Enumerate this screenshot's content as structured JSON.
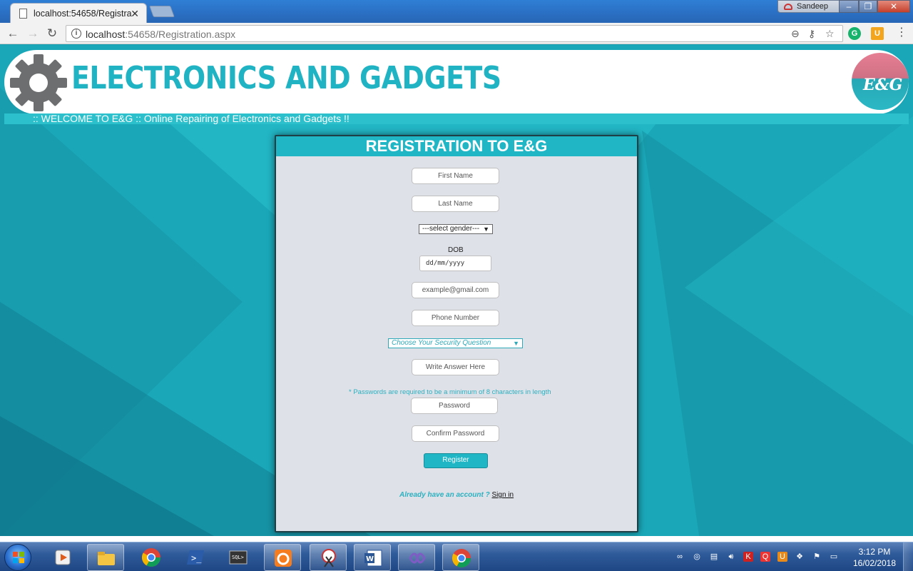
{
  "browser": {
    "tab_title": "localhost:54658/Registra",
    "url_host": "localhost",
    "url_rest": ":54658/Registration.aspx",
    "user_name": "Sandeep"
  },
  "site": {
    "brand": "ELECTRONICS AND GADGETS",
    "logo_text": "E&G",
    "welcome": ":: WELCOME TO E&G :: Online Repairing of Electronics and Gadgets !!"
  },
  "form": {
    "title": "REGISTRATION TO E&G",
    "first_name_placeholder": "First Name",
    "last_name_placeholder": "Last Name",
    "gender_selected": "---select gender---",
    "dob_label": "DOB",
    "dob_placeholder": "dd/mm/yyyy",
    "email_placeholder": "example@gmail.com",
    "phone_placeholder": "Phone Number",
    "security_question_selected": "Choose Your Security Question",
    "answer_placeholder": "Write Answer Here",
    "password_hint": "* Passwords are required to be a minimum of 8 characters in length",
    "password_placeholder": "Password",
    "confirm_password_placeholder": "Confirm Password",
    "register_label": "Register",
    "already_text": "Already have an account ?",
    "sign_in_label": "Sign  in"
  },
  "colors": {
    "accent": "#20b6c6",
    "card_bg": "#dfe1e8",
    "brand_text": "#1fb3c3"
  },
  "taskbar": {
    "items": [
      "media-player-icon",
      "file-explorer-icon",
      "chrome-icon",
      "powershell-icon",
      "sql-plus-icon",
      "uc-browser-icon",
      "snipping-tool-icon",
      "word-icon",
      "visual-studio-icon",
      "chrome-active-icon"
    ],
    "time": "3:12 PM",
    "date": "16/02/2018"
  }
}
